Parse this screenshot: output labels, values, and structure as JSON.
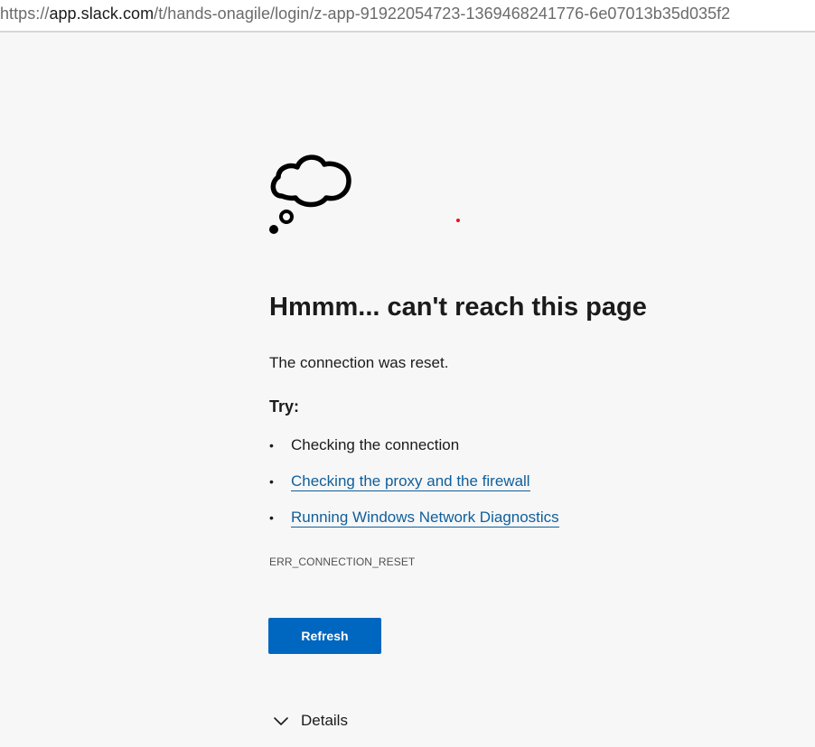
{
  "address_bar": {
    "url_scheme": "https://",
    "url_host": "app.slack.com",
    "url_path": "/t/hands-onagile/login/z-app-91922054723-1369468241776-6e07013b35d035f2"
  },
  "error_page": {
    "icon": "thought-cloud-icon",
    "title": "Hmmm... can't reach this page",
    "message": "The connection was reset.",
    "try_heading": "Try:",
    "suggestions": [
      {
        "label": "Checking the connection",
        "is_link": false
      },
      {
        "label": "Checking the proxy and the firewall",
        "is_link": true
      },
      {
        "label": "Running Windows Network Diagnostics",
        "is_link": true
      }
    ],
    "error_code": "ERR_CONNECTION_RESET",
    "refresh_label": "Refresh",
    "details_label": "Details"
  },
  "colors": {
    "background": "#f7f7f7",
    "link": "#0f5f9c",
    "button": "#0067c0",
    "button_text": "#ffffff",
    "text": "#1b1b1b"
  }
}
